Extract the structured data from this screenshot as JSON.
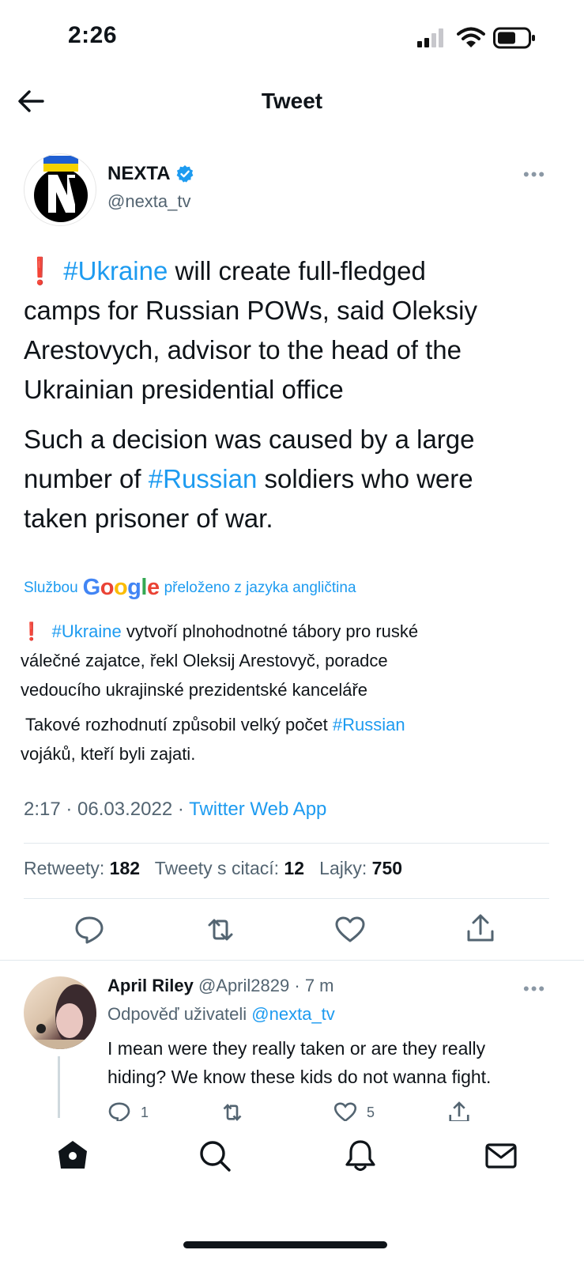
{
  "status_bar": {
    "time": "2:26"
  },
  "header": {
    "title": "Tweet"
  },
  "tweet": {
    "author_name": "NEXTA",
    "author_handle": "@nexta_tv",
    "paragraph1_lines": [
      "❗ #Ukraine will create full-fledged",
      "camps for Russian POWs, said Oleksiy",
      "Arestovych, advisor to the head of the",
      "Ukrainian presidential office"
    ],
    "paragraph2_lines": [
      "Such a decision was caused by a large",
      "number of #Russian soldiers who were",
      "taken prisoner of war."
    ],
    "translation": {
      "prefix": "Službou",
      "provider": "Google",
      "suffix": "přeloženo z jazyka angličtina",
      "paragraph1_lines": [
        "❗  #Ukraine vytvoří plnohodnotné tábory pro ruské",
        "válečné zajatce, řekl Oleksij Arestovyč, poradce",
        "vedoucího ukrajinské prezidentské kanceláře"
      ],
      "paragraph2_lines": [
        " Takové rozhodnutí způsobil velký počet #Russian",
        "vojáků, kteří byli zajati."
      ]
    },
    "time": "2:17",
    "date": "06.03.2022",
    "source": "Twitter Web App",
    "stats": {
      "retweets_label": "Retweety:",
      "retweets": "182",
      "quotes_label": "Tweety s citací:",
      "quotes": "12",
      "likes_label": "Lajky:",
      "likes": "750"
    }
  },
  "reply": {
    "name": "April Riley",
    "handle": "@April2829",
    "time": "7 m",
    "reply_to_prefix": "Odpověď uživateli",
    "reply_to_handle": "@nexta_tv",
    "text_lines": [
      "I mean were they really taken or are they really",
      "hiding?  We know these kids do not wanna fight."
    ],
    "reply_count": "1",
    "like_count": "5"
  },
  "icons": {
    "back": "arrow-left-icon",
    "more": "more-horizontal-icon",
    "verified": "verified-badge-icon",
    "reply": "comment-icon",
    "retweet": "retweet-icon",
    "like": "heart-icon",
    "share": "share-icon",
    "nav": [
      "home-icon",
      "search-icon",
      "notifications-bell-icon",
      "messages-mail-icon"
    ]
  },
  "colors": {
    "accent": "#1d9bf0",
    "text": "#0f1419",
    "secondary": "#536471"
  }
}
